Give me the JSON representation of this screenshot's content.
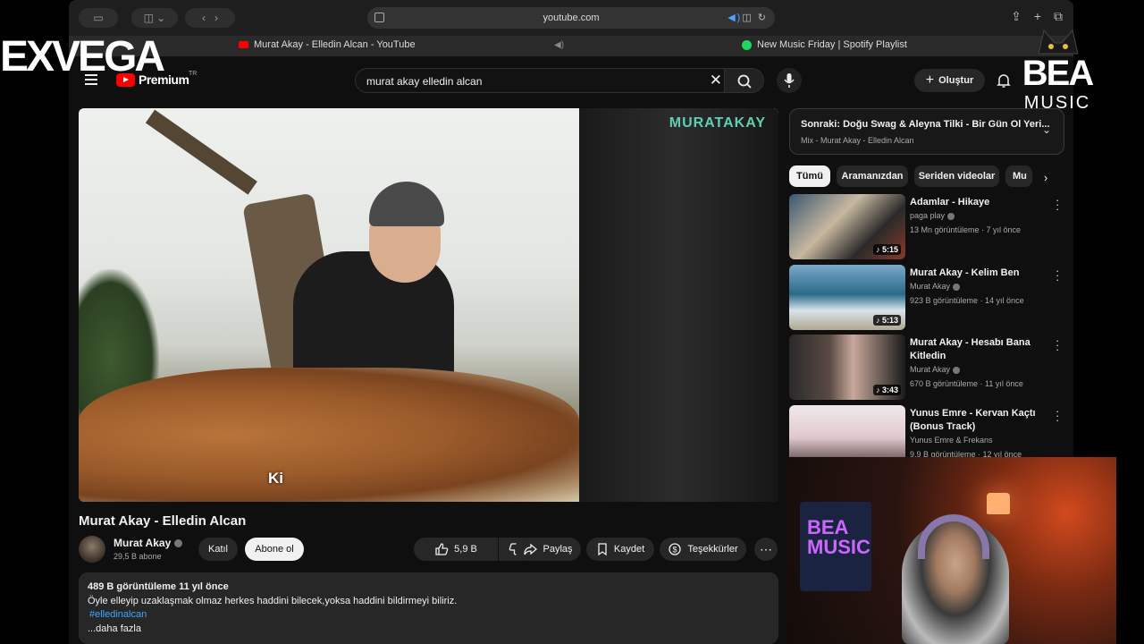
{
  "browser": {
    "url": "youtube.com",
    "tabs": [
      {
        "title": "Murat Akay - Elledin Alcan - YouTube"
      },
      {
        "title": "New Music Friday | Spotify Playlist"
      }
    ]
  },
  "header": {
    "logo_text": "Premium",
    "logo_region": "TR",
    "search_value": "murat akay elledin alcan",
    "create_label": "Oluştur"
  },
  "video": {
    "watermark": "MURATAKAY",
    "subtitle": "Ki",
    "title": "Murat Akay - Elledin Alcan"
  },
  "channel": {
    "name": "Murat Akay",
    "subscribers": "29,5 B abone"
  },
  "actions": {
    "join": "Katıl",
    "subscribe": "Abone ol",
    "likes": "5,9 B",
    "share": "Paylaş",
    "save": "Kaydet",
    "thanks": "Teşekkürler"
  },
  "description": {
    "meta": "489 B görüntüleme  11 yıl önce",
    "text": "Öyle elleyip uzaklaşmak olmaz herkes haddini bilecek,yoksa haddini bildirmeyi biliriz.",
    "hashtag": "#elledinalcan",
    "more": "...daha fazla"
  },
  "up_next": {
    "title": "Sonraki: Doğu Swag & Aleyna Tilki - Bir Gün Ol Yeri...",
    "subtitle": "Mix - Murat Akay - Elledin Alcan"
  },
  "chips": [
    "Tümü",
    "Aramanızdan",
    "Seriden videolar",
    "Mu"
  ],
  "recommendations": [
    {
      "title": "Adamlar - Hikaye",
      "channel": "paga play",
      "meta": "13 Mn görüntüleme · 7 yıl önce",
      "duration": "5:15"
    },
    {
      "title": "Murat Akay - Kelim Ben",
      "channel": "Murat Akay",
      "meta": "923 B görüntüleme · 14 yıl önce",
      "duration": "5:13"
    },
    {
      "title": "Murat Akay - Hesabı Bana Kitledin",
      "channel": "Murat Akay",
      "meta": "670 B görüntüleme · 11 yıl önce",
      "duration": "3:43"
    },
    {
      "title": "Yunus Emre - Kervan Kaçtı (Bonus Track)",
      "channel": "Yunus Emre & Frekans",
      "meta": "9,9 B görüntüleme · 12 yıl önce",
      "duration": ""
    }
  ],
  "overlay": {
    "left_brand": "EXVEGA",
    "right_brand_top": "BEA",
    "right_brand_bottom": "MUSIC",
    "webcam_poster": "BEA MUSIC"
  },
  "colors": {
    "youtube_red": "#ff0000",
    "link_blue": "#3ea6ff",
    "spotify_green": "#1ed760"
  }
}
